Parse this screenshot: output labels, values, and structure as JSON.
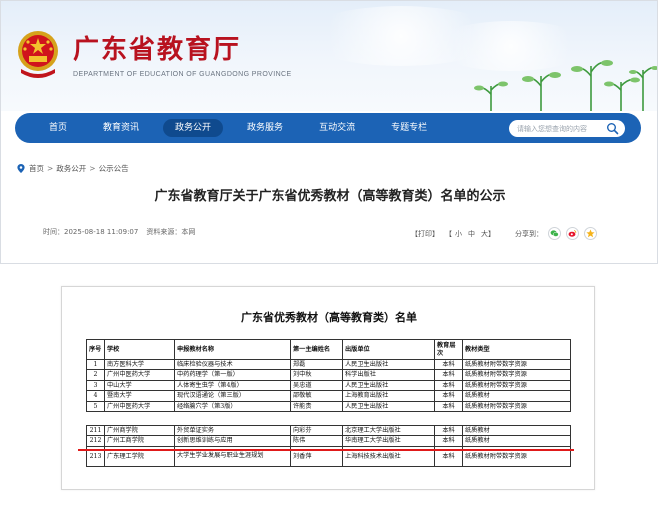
{
  "site": {
    "title": "广东省教育厅",
    "subtitle": "DEPARTMENT OF EDUCATION OF GUANGDONG PROVINCE"
  },
  "nav": {
    "items": [
      {
        "label": "首页"
      },
      {
        "label": "教育资讯"
      },
      {
        "label": "政务公开"
      },
      {
        "label": "政务服务"
      },
      {
        "label": "互动交流"
      },
      {
        "label": "专题专栏"
      }
    ],
    "active_index": 2,
    "search_placeholder": "请输入您想查询的内容"
  },
  "breadcrumb": {
    "items": [
      "首页",
      "政务公开",
      "公示公告"
    ],
    "separator": ">"
  },
  "article": {
    "title": "广东省教育厅关于广东省优秀教材（高等教育类）名单的公示",
    "time_label": "时间：",
    "time": "2025-08-18 11:09:07",
    "source_label": "资料来源：",
    "source": "本网",
    "print": "【打印】",
    "font_size": [
      "【",
      "小",
      "中",
      "大",
      "】"
    ],
    "share_label": "分享到："
  },
  "document": {
    "title": "广东省优秀教材（高等教育类）名单",
    "headers": [
      "序号",
      "学校",
      "申报教材名称",
      "第一主编姓名",
      "出版单位",
      "教育层次",
      "教材类型"
    ],
    "rows_top": [
      [
        "1",
        "南方医科大学",
        "临床检验仪器与技术",
        "郑磊",
        "人民卫生出版社",
        "本科",
        "纸质教材附带数字资源"
      ],
      [
        "2",
        "广州中医药大学",
        "中药药理学（第一版）",
        "刘中秋",
        "科学出版社",
        "本科",
        "纸质教材附带数字资源"
      ],
      [
        "3",
        "中山大学",
        "人体寄生虫学（第4版）",
        "吴忠道",
        "人民卫生出版社",
        "本科",
        "纸质教材附带数字资源"
      ],
      [
        "4",
        "暨南大学",
        "现代汉语通论（第三版）",
        "邵敬敏",
        "上海教育出版社",
        "本科",
        "纸质教材"
      ],
      [
        "5",
        "广州中医药大学",
        "经络腧穴学（第3版）",
        "许能贵",
        "人民卫生出版社",
        "本科",
        "纸质教材附带数字资源"
      ]
    ],
    "rows_bottom": [
      [
        "211",
        "广州商学院",
        "外贸单证实务",
        "向彩芬",
        "北京理工大学出版社",
        "本科",
        "纸质教材"
      ],
      [
        "212",
        "广州工商学院",
        "创新思维训练与应用",
        "陈伟",
        "华南理工大学出版社",
        "本科",
        "纸质教材"
      ],
      [
        "213",
        "广东理工学院",
        "大学生学业发展与职业生涯规划",
        "刘香萍",
        "上海科技技术出版社",
        "本科",
        "纸质教材附带数字资源"
      ]
    ]
  },
  "colors": {
    "nav_blue": "#1c63b5",
    "nav_active": "#0f4a8e",
    "title_red": "#b8121f",
    "highlight_line": "#e01a1a"
  },
  "icons": [
    "national-emblem-icon",
    "search-icon",
    "location-icon",
    "wechat-icon",
    "weibo-icon",
    "qzone-icon"
  ]
}
